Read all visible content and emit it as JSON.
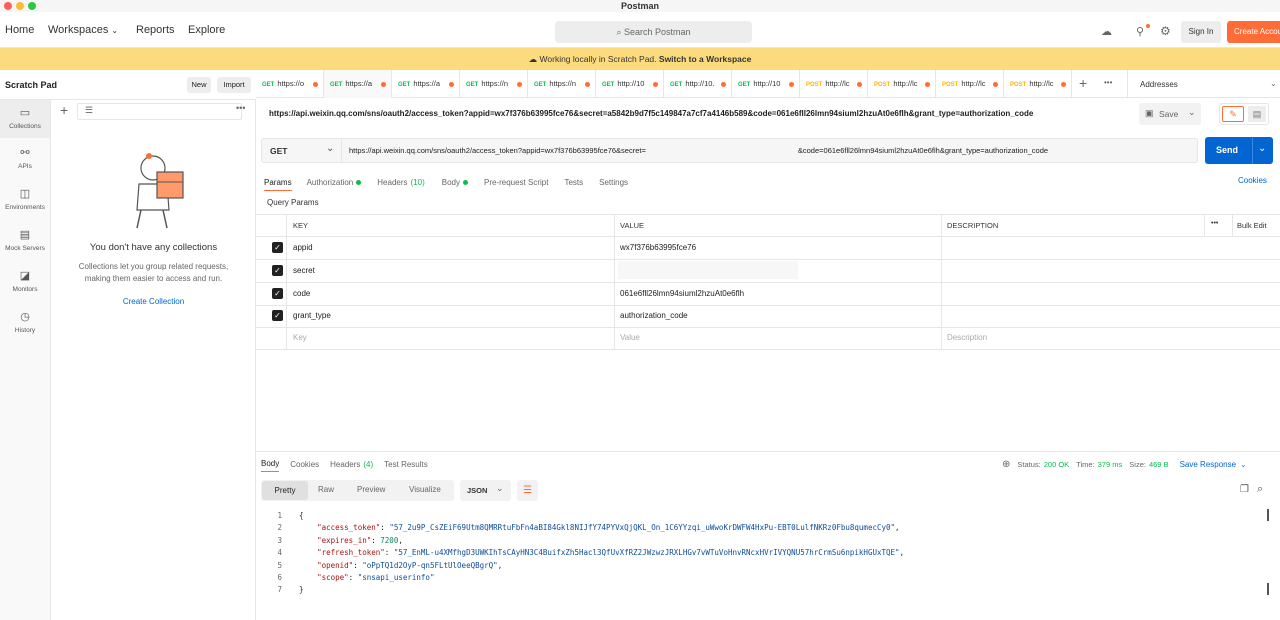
{
  "window": {
    "title": "Postman"
  },
  "nav": {
    "home": "Home",
    "workspaces": "Workspaces",
    "reports": "Reports",
    "explore": "Explore",
    "search_placeholder": "Search Postman",
    "sign_in": "Sign In",
    "create_account": "Create Account"
  },
  "banner": {
    "text": "Working locally in Scratch Pad.",
    "link": "Switch to a Workspace"
  },
  "sidebar": {
    "title": "Scratch Pad",
    "new_btn": "New",
    "import_btn": "Import",
    "rail": [
      {
        "label": "Collections",
        "icon": "collections-icon"
      },
      {
        "label": "APIs",
        "icon": "apis-icon"
      },
      {
        "label": "Environments",
        "icon": "environments-icon"
      },
      {
        "label": "Mock Servers",
        "icon": "mock-servers-icon"
      },
      {
        "label": "Monitors",
        "icon": "monitors-icon"
      },
      {
        "label": "History",
        "icon": "history-icon"
      }
    ],
    "empty_title": "You don't have any collections",
    "empty_desc1": "Collections let you group related requests,",
    "empty_desc2": "making them easier to access and run.",
    "create_link": "Create Collection"
  },
  "tabs": [
    {
      "method": "GET",
      "label": "https://o"
    },
    {
      "method": "GET",
      "label": "https://a"
    },
    {
      "method": "GET",
      "label": "https://a"
    },
    {
      "method": "GET",
      "label": "https://n"
    },
    {
      "method": "GET",
      "label": "https://n"
    },
    {
      "method": "GET",
      "label": "http://10"
    },
    {
      "method": "GET",
      "label": "http://10."
    },
    {
      "method": "GET",
      "label": "http://10"
    },
    {
      "method": "POST",
      "label": "http://lc"
    },
    {
      "method": "POST",
      "label": "http://lc"
    },
    {
      "method": "POST",
      "label": "http://lc"
    },
    {
      "method": "POST",
      "label": "http://lc"
    }
  ],
  "environment": "Addresses",
  "request": {
    "title": "https://api.weixin.qq.com/sns/oauth2/access_token?appid=wx7f376b63995fce76&secret=a5842b9d7f5c149847a7cf7a4146b589&code=061e6fll26lmn94siuml2hzuAt0e6flh&grant_type=authorization_code",
    "save": "Save",
    "method": "GET",
    "url_part1": "https://api.weixin.qq.com/sns/oauth2/access_token?appid=wx7f376b63995fce76&secret=",
    "url_part2": "&code=061e6fll26lmn94siuml2hzuAt0e6flh&grant_type=authorization_code",
    "send": "Send"
  },
  "req_tabs": {
    "params": "Params",
    "authorization": "Authorization",
    "headers": "Headers",
    "headers_count": "(10)",
    "body": "Body",
    "prerequest": "Pre-request Script",
    "tests": "Tests",
    "settings": "Settings",
    "cookies": "Cookies"
  },
  "params": {
    "section_title": "Query Params",
    "headers": {
      "key": "KEY",
      "value": "VALUE",
      "description": "DESCRIPTION",
      "bulk": "Bulk Edit"
    },
    "rows": [
      {
        "key": "appid",
        "value": "wx7f376b63995fce76"
      },
      {
        "key": "secret",
        "value": ""
      },
      {
        "key": "code",
        "value": "061e6fll26lmn94siuml2hzuAt0e6flh"
      },
      {
        "key": "grant_type",
        "value": "authorization_code"
      }
    ],
    "placeholders": {
      "key": "Key",
      "value": "Value",
      "description": "Description"
    }
  },
  "response": {
    "tabs": {
      "body": "Body",
      "cookies": "Cookies",
      "headers": "Headers",
      "headers_count": "(4)",
      "tests": "Test Results"
    },
    "status_label": "Status:",
    "status": "200 OK",
    "time_label": "Time:",
    "time": "379 ms",
    "size_label": "Size:",
    "size": "469 B",
    "save": "Save Response",
    "views": {
      "pretty": "Pretty",
      "raw": "Raw",
      "preview": "Preview",
      "visualize": "Visualize",
      "format": "JSON"
    },
    "json": {
      "access_token_key": "\"access_token\"",
      "access_token": "\"57_2u9P_CsZEiF69Utm8QMRRtuFbFn4aBI84Gkl8NIJfY74PYVxQjQKL_On_1C6YYzqi_uWwoKrDWFW4HxPu-EBT0LulfNKRz0Fbu8qumecCy0\"",
      "expires_in_key": "\"expires_in\"",
      "expires_in": "7200",
      "refresh_token_key": "\"refresh_token\"",
      "refresh_token": "\"57_EnML-u4XMfhgD3UWKIhTsCAyHN3C4BuifxZh5Hacl3QfUvXfRZ2JWzwzJRXLHGv7vWTuVoHnvRNcxHVrIVYQNU57hrCrmSu6npikHGUxTQE\"",
      "openid_key": "\"openid\"",
      "openid": "\"oPpTQ1d2OyP-qn5FLtUlOeeQBgrQ\"",
      "scope_key": "\"scope\"",
      "scope": "\"snsapi_userinfo\""
    }
  }
}
